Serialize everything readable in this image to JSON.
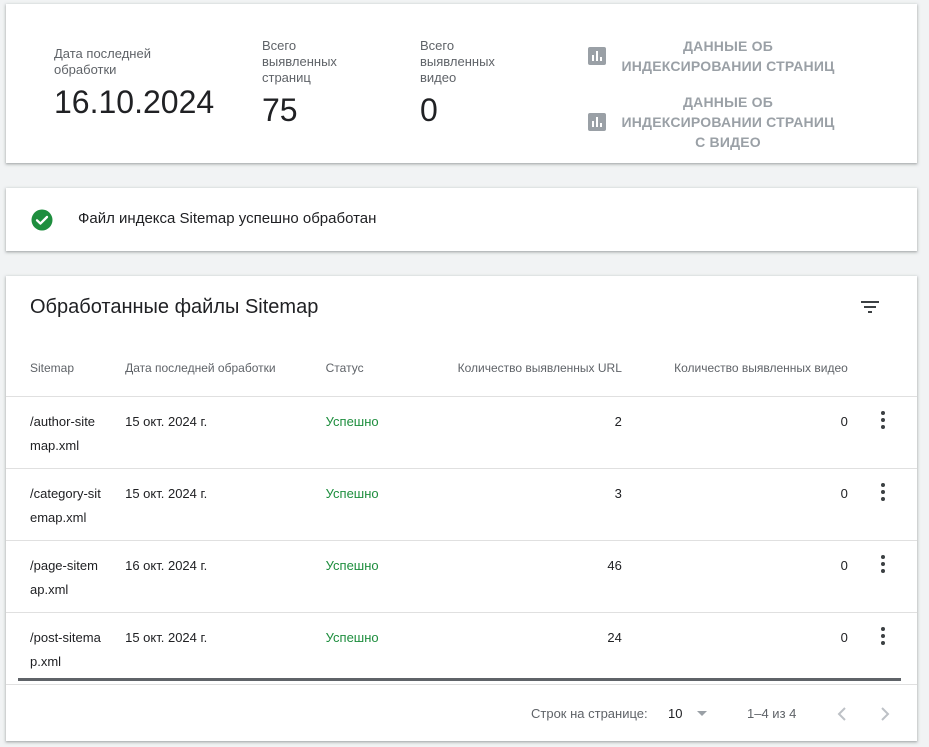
{
  "summary": {
    "last_processed_label": "Дата последней обработки",
    "last_processed_value": "16.10.2024",
    "pages_label": "Всего выявленных страниц",
    "pages_value": "75",
    "videos_label": "Всего выявленных видео",
    "videos_value": "0",
    "report_pages": "ДАННЫЕ ОБ ИНДЕКСИРОВАНИИ СТРАНИЦ",
    "report_videos": "ДАННЫЕ ОБ ИНДЕКСИРОВАНИИ СТРАНИЦ С ВИДЕО",
    "report_icon": "bar-chart-icon"
  },
  "status_message": {
    "icon": "check-circle-icon",
    "text": "Файл индекса Sitemap успешно обработан"
  },
  "table": {
    "title": "Обработанные файлы Sitemap",
    "columns": {
      "sitemap": "Sitemap",
      "date": "Дата последней обработки",
      "status": "Статус",
      "urls": "Количество выявленных URL",
      "videos": "Количество выявленных видео"
    },
    "rows": [
      {
        "sitemap": "/author-sitemap.xml",
        "date": "15 окт. 2024 г.",
        "status": "Успешно",
        "urls": "2",
        "videos": "0"
      },
      {
        "sitemap": "/category-sitemap.xml",
        "date": "15 окт. 2024 г.",
        "status": "Успешно",
        "urls": "3",
        "videos": "0"
      },
      {
        "sitemap": "/page-sitemap.xml",
        "date": "16 окт. 2024 г.",
        "status": "Успешно",
        "urls": "46",
        "videos": "0"
      },
      {
        "sitemap": "/post-sitemap.xml",
        "date": "15 окт. 2024 г.",
        "status": "Успешно",
        "urls": "24",
        "videos": "0"
      }
    ],
    "pagination": {
      "rows_per_page_label": "Строк на странице:",
      "rows_per_page_value": "10",
      "range": "1–4 из 4"
    }
  },
  "colors": {
    "success": "#1e8e3e",
    "muted_text": "#5f6368",
    "disabled": "#9aa0a6"
  }
}
